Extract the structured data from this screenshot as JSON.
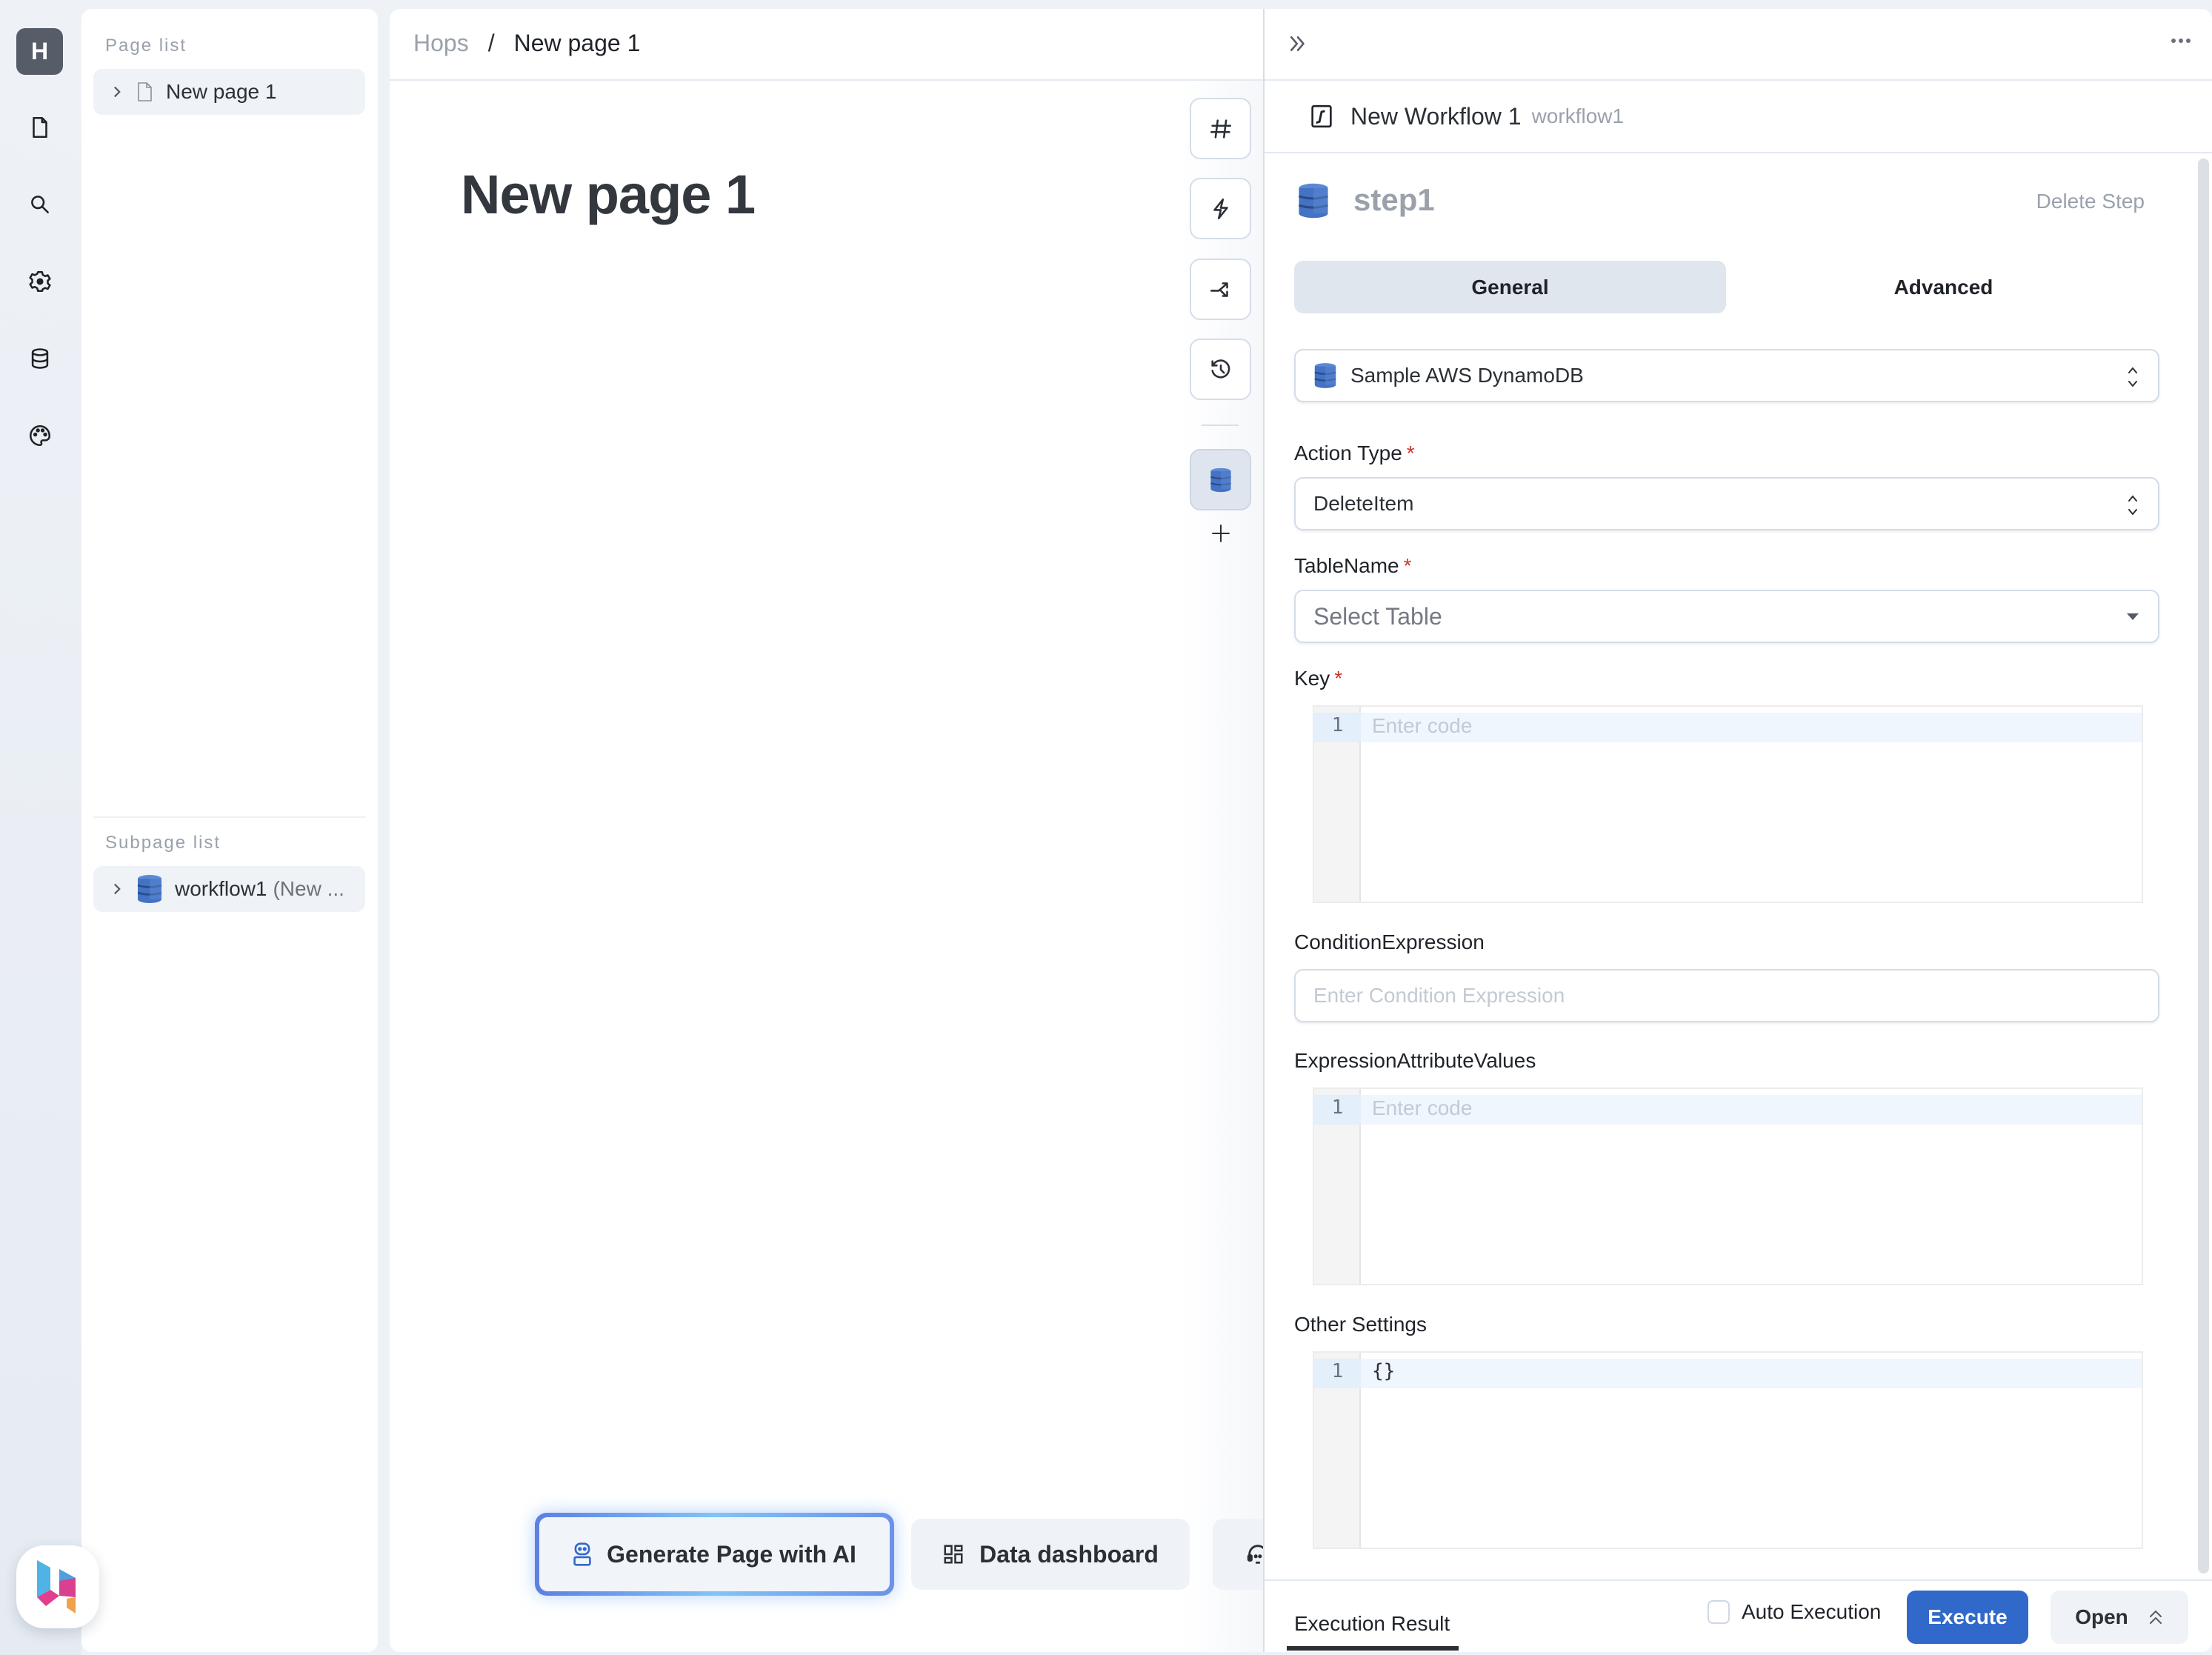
{
  "rail": {
    "avatar_letter": "H",
    "items": [
      {
        "name": "pages",
        "icon": "file-icon"
      },
      {
        "name": "search",
        "icon": "search-icon"
      },
      {
        "name": "settings",
        "icon": "gear-icon"
      },
      {
        "name": "database",
        "icon": "database-icon"
      },
      {
        "name": "theme",
        "icon": "palette-icon"
      }
    ]
  },
  "page_list": {
    "label": "Page list",
    "items": [
      {
        "label": "New page 1",
        "icon": "file-icon"
      }
    ]
  },
  "subpage_list": {
    "label": "Subpage list",
    "items": [
      {
        "label": "workflow1",
        "suffix": "(New ...",
        "icon": "dynamodb-icon"
      }
    ]
  },
  "breadcrumb": {
    "root": "Hops",
    "separator": "/",
    "current": "New page 1"
  },
  "page": {
    "title": "New page 1"
  },
  "toolbar": {
    "buttons": [
      {
        "name": "hash",
        "icon": "hash-icon"
      },
      {
        "name": "trigger",
        "icon": "lightning-icon"
      },
      {
        "name": "branch",
        "icon": "branch-icon"
      },
      {
        "name": "history",
        "icon": "history-icon"
      },
      {
        "name": "dynamodb-step",
        "icon": "dynamodb-icon",
        "active": true
      }
    ],
    "add": "+"
  },
  "bottom_actions": [
    {
      "label": "Generate Page with AI",
      "icon": "robot-icon"
    },
    {
      "label": "Data dashboard",
      "icon": "dashboard-icon"
    },
    {
      "label": "",
      "icon": "headset-icon"
    }
  ],
  "workflow_panel": {
    "title": "New Workflow 1",
    "id": "workflow1",
    "step": {
      "name": "step1",
      "delete_label": "Delete Step"
    },
    "tabs": [
      {
        "label": "General",
        "active": true
      },
      {
        "label": "Advanced",
        "active": false
      }
    ],
    "datasource": {
      "value": "Sample AWS DynamoDB"
    },
    "fields": {
      "action_type": {
        "label": "Action Type",
        "required": "*",
        "value": "DeleteItem"
      },
      "table_name": {
        "label": "TableName",
        "required": "*",
        "placeholder": "Select Table"
      },
      "key": {
        "label": "Key",
        "required": "*",
        "line": "1",
        "placeholder": "Enter code"
      },
      "condition_expression": {
        "label": "ConditionExpression",
        "placeholder": "Enter Condition Expression",
        "value": ""
      },
      "expression_attribute_values": {
        "label": "ExpressionAttributeValues",
        "line": "1",
        "placeholder": "Enter code"
      },
      "other_settings": {
        "label": "Other Settings",
        "line": "1",
        "value": "{}"
      }
    },
    "footer": {
      "result_tab": "Execution Result",
      "auto_execution_label": "Auto Execution",
      "auto_execution_checked": false,
      "execute_label": "Execute",
      "open_label": "Open"
    }
  },
  "colors": {
    "accent": "#3069c9",
    "required": "#d0332b",
    "dynamodb": "#4472c4",
    "tab_active_bg": "#dfe6ee"
  }
}
